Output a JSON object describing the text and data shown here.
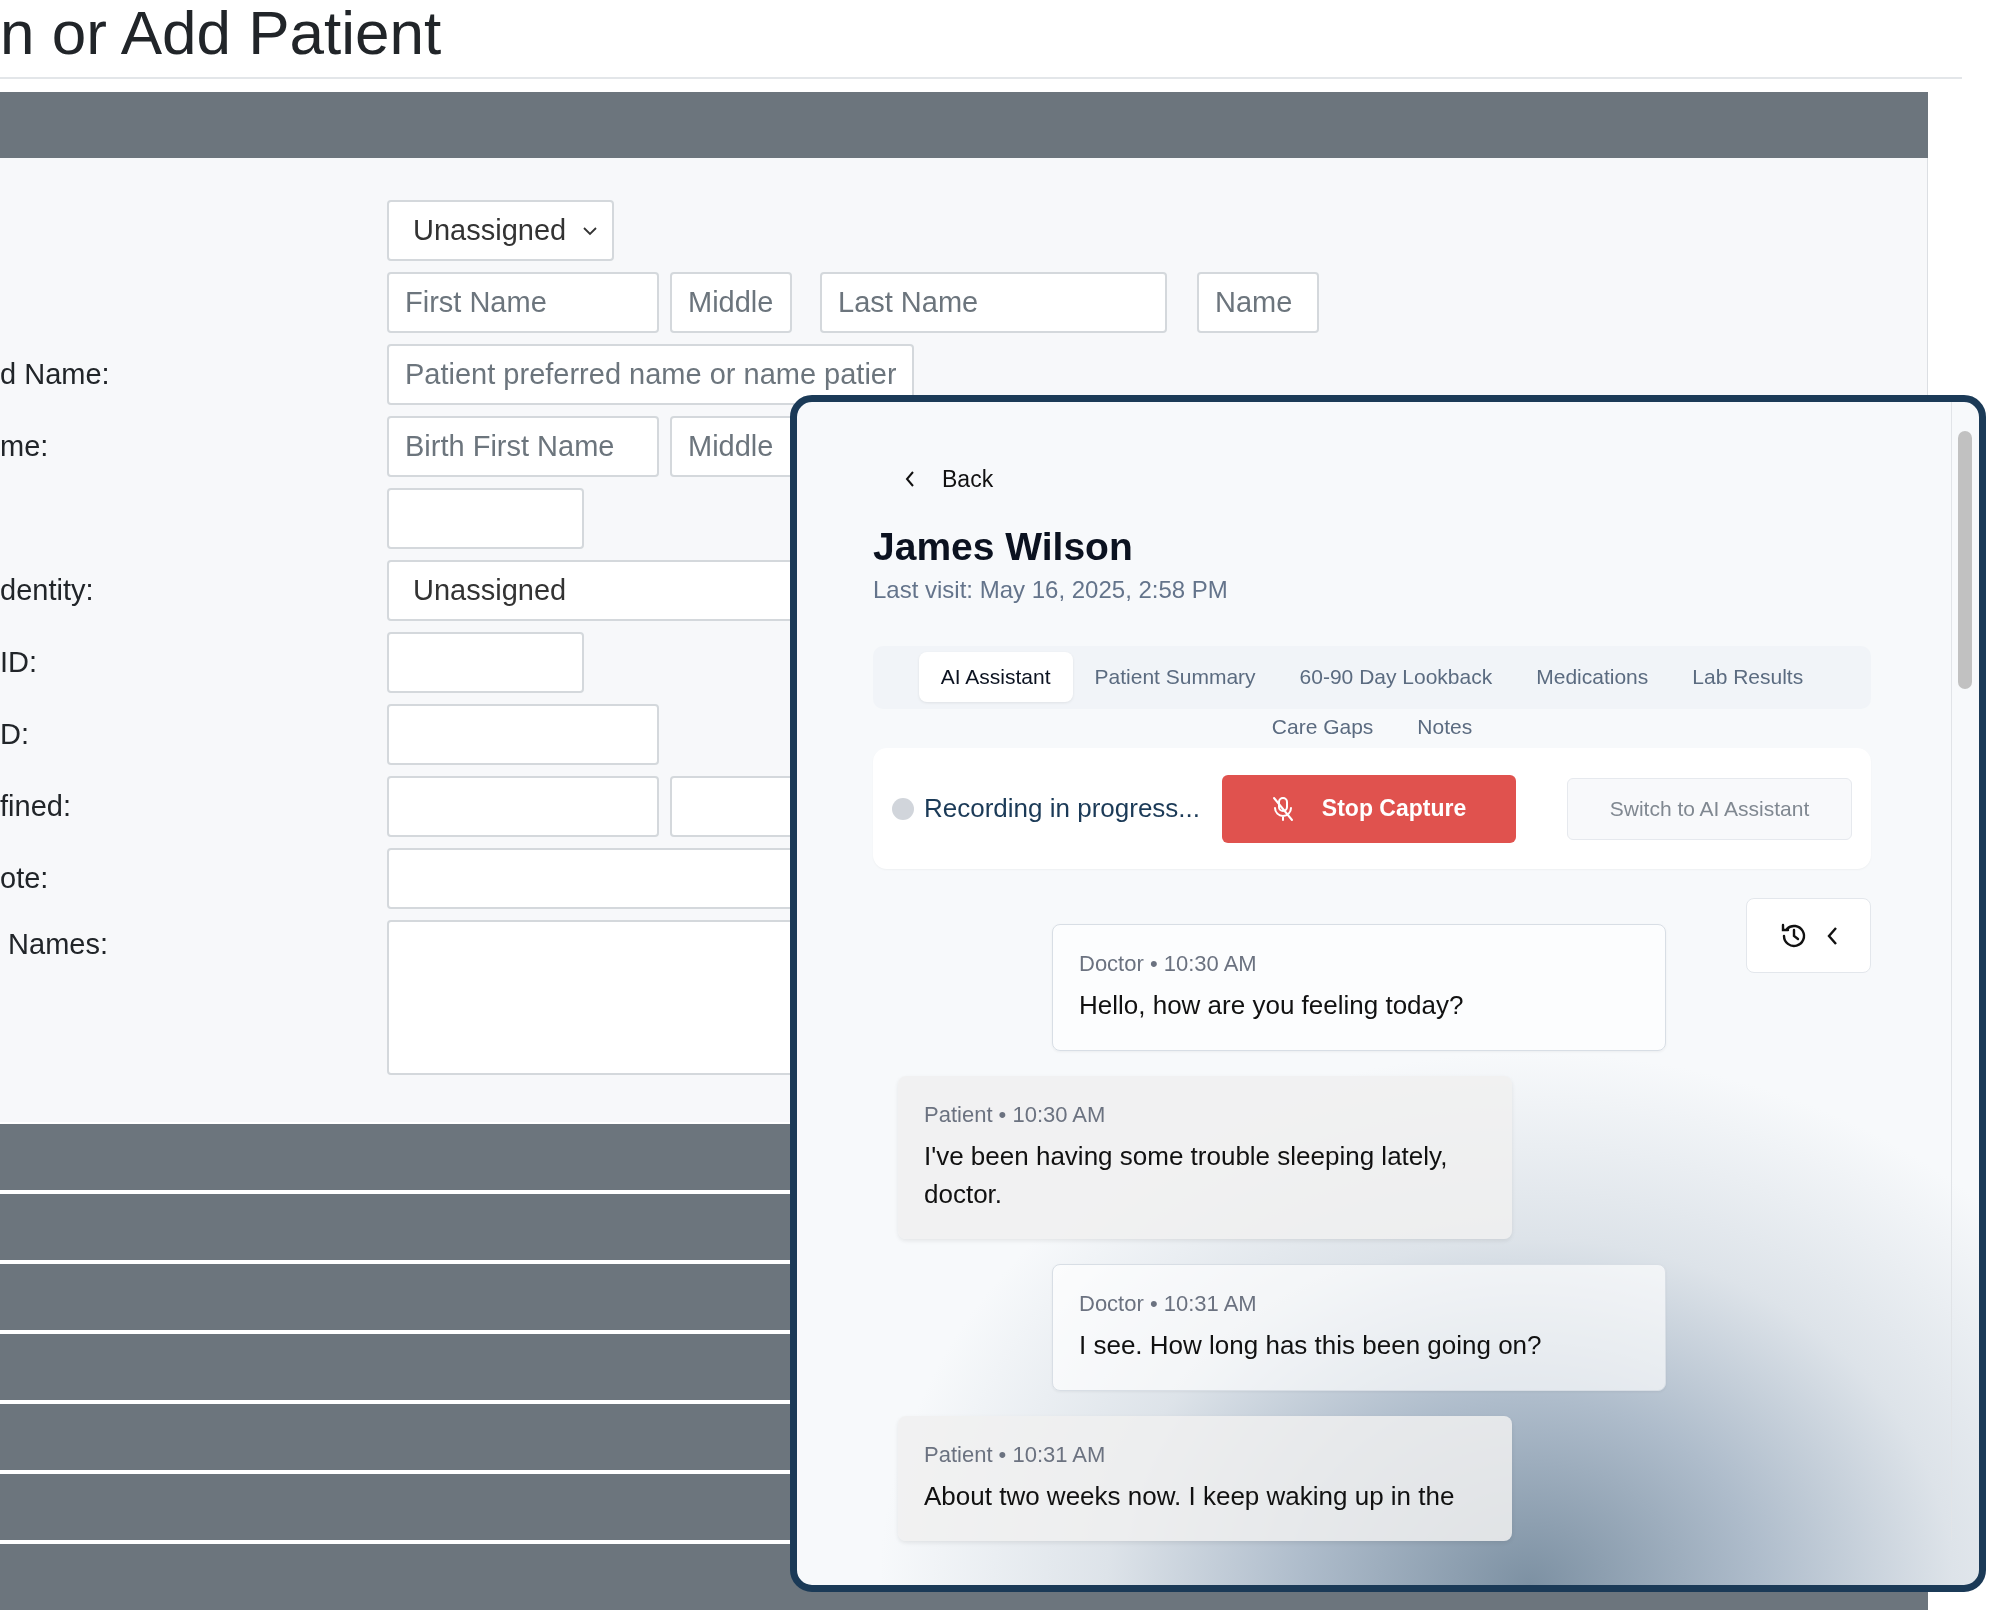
{
  "page_title": "n or Add Patient",
  "form": {
    "rows": [
      {
        "fields": [
          {
            "kind": "select",
            "value": "Unassigned"
          }
        ]
      },
      {
        "fields": [
          {
            "kind": "input",
            "placeholder": "First Name"
          },
          {
            "kind": "input",
            "placeholder": "Middle"
          },
          {
            "kind": "input",
            "placeholder": "Last Name"
          },
          {
            "kind": "input",
            "placeholder": "Name"
          }
        ]
      },
      {
        "label": "d Name:",
        "fields": [
          {
            "kind": "input",
            "placeholder": "Patient preferred name or name patier"
          }
        ]
      },
      {
        "label": "me:",
        "fields": [
          {
            "kind": "input",
            "placeholder": "Birth First Name"
          },
          {
            "kind": "input",
            "placeholder": "Middle"
          }
        ]
      },
      {
        "fields": [
          {
            "kind": "input"
          }
        ]
      },
      {
        "label": "dentity:",
        "fields": [
          {
            "kind": "select",
            "value": "Unassigned"
          }
        ]
      },
      {
        "label": "ID:",
        "fields": [
          {
            "kind": "input"
          }
        ]
      },
      {
        "label": "D:",
        "fields": [
          {
            "kind": "input"
          }
        ]
      },
      {
        "label": "fined:",
        "fields": [
          {
            "kind": "input"
          },
          {
            "kind": "input"
          }
        ]
      },
      {
        "label": "ote:",
        "fields": [
          {
            "kind": "input"
          }
        ]
      },
      {
        "label": " Names:",
        "fields": [
          {
            "kind": "textarea"
          }
        ]
      }
    ]
  },
  "panel": {
    "back": "Back",
    "patient_name": "James Wilson",
    "last_visit": "Last visit: May 16, 2025, 2:58 PM",
    "tabs": [
      {
        "label": "AI Assistant",
        "selected": true
      },
      {
        "label": "Patient Summary",
        "selected": false
      },
      {
        "label": "60-90 Day Lookback",
        "selected": false
      },
      {
        "label": "Medications",
        "selected": false
      },
      {
        "label": "Lab Results",
        "selected": false
      },
      {
        "label": "Care Gaps",
        "selected": false
      },
      {
        "label": "Notes",
        "selected": false
      }
    ],
    "recording": {
      "status": "Recording in progress...",
      "stop_button": "Stop Capture",
      "switch_button": {
        "label": "Switch to AI Assistant",
        "disabled": true
      }
    },
    "messages": [
      {
        "kind": "doctor",
        "meta": "Doctor • 10:30 AM",
        "text": "Hello, how are you feeling today?"
      },
      {
        "kind": "patient",
        "meta": "Patient • 10:30 AM",
        "text": "I've been having some trouble sleeping lately, doctor."
      },
      {
        "kind": "doctor",
        "meta": "Doctor • 10:31 AM",
        "text": "I see. How long has this been going on?"
      },
      {
        "kind": "patient",
        "meta": "Patient • 10:31 AM",
        "text": "About two weeks now. I keep waking up in the"
      }
    ]
  }
}
